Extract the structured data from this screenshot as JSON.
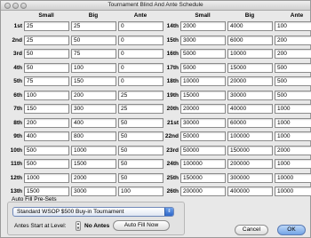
{
  "window": {
    "title": "Tournament Blind And Ante Schedule"
  },
  "table": {
    "headers": {
      "small": "Small",
      "big": "Big",
      "ante": "Ante"
    },
    "left": [
      {
        "level": "1st",
        "small": "25",
        "big": "25",
        "ante": "0"
      },
      {
        "level": "2nd",
        "small": "25",
        "big": "50",
        "ante": "0"
      },
      {
        "level": "3rd",
        "small": "50",
        "big": "75",
        "ante": "0"
      },
      {
        "level": "4th",
        "small": "50",
        "big": "100",
        "ante": "0"
      },
      {
        "level": "5th",
        "small": "75",
        "big": "150",
        "ante": "0"
      },
      {
        "level": "6th",
        "small": "100",
        "big": "200",
        "ante": "25"
      },
      {
        "level": "7th",
        "small": "150",
        "big": "300",
        "ante": "25"
      },
      {
        "level": "8th",
        "small": "200",
        "big": "400",
        "ante": "50"
      },
      {
        "level": "9th",
        "small": "400",
        "big": "800",
        "ante": "50"
      },
      {
        "level": "10th",
        "small": "500",
        "big": "1000",
        "ante": "50"
      },
      {
        "level": "11th",
        "small": "500",
        "big": "1500",
        "ante": "50"
      },
      {
        "level": "12th",
        "small": "1000",
        "big": "2000",
        "ante": "50"
      },
      {
        "level": "13th",
        "small": "1500",
        "big": "3000",
        "ante": "100"
      }
    ],
    "right": [
      {
        "level": "14th",
        "small": "2000",
        "big": "4000",
        "ante": "100"
      },
      {
        "level": "15th",
        "small": "3000",
        "big": "6000",
        "ante": "200"
      },
      {
        "level": "16th",
        "small": "5000",
        "big": "10000",
        "ante": "200"
      },
      {
        "level": "17th",
        "small": "5000",
        "big": "15000",
        "ante": "500"
      },
      {
        "level": "18th",
        "small": "10000",
        "big": "20000",
        "ante": "500"
      },
      {
        "level": "19th",
        "small": "15000",
        "big": "30000",
        "ante": "500"
      },
      {
        "level": "20th",
        "small": "20000",
        "big": "40000",
        "ante": "1000"
      },
      {
        "level": "21st",
        "small": "30000",
        "big": "60000",
        "ante": "1000"
      },
      {
        "level": "22nd",
        "small": "50000",
        "big": "100000",
        "ante": "1000"
      },
      {
        "level": "23rd",
        "small": "50000",
        "big": "150000",
        "ante": "2000"
      },
      {
        "level": "24th",
        "small": "100000",
        "big": "200000",
        "ante": "1000"
      },
      {
        "level": "25th",
        "small": "150000",
        "big": "300000",
        "ante": "10000"
      },
      {
        "level": "26th",
        "small": "200000",
        "big": "400000",
        "ante": "10000"
      }
    ]
  },
  "presets": {
    "group_label": "Auto Fill Pre-Sets",
    "selected": "Standard WSOP $500 Buy-in Tournament",
    "antes_label": "Antes Start at Level:",
    "antes_value": "No Antes",
    "auto_fill_label": "Auto Fill Now"
  },
  "buttons": {
    "cancel": "Cancel",
    "ok": "OK"
  }
}
